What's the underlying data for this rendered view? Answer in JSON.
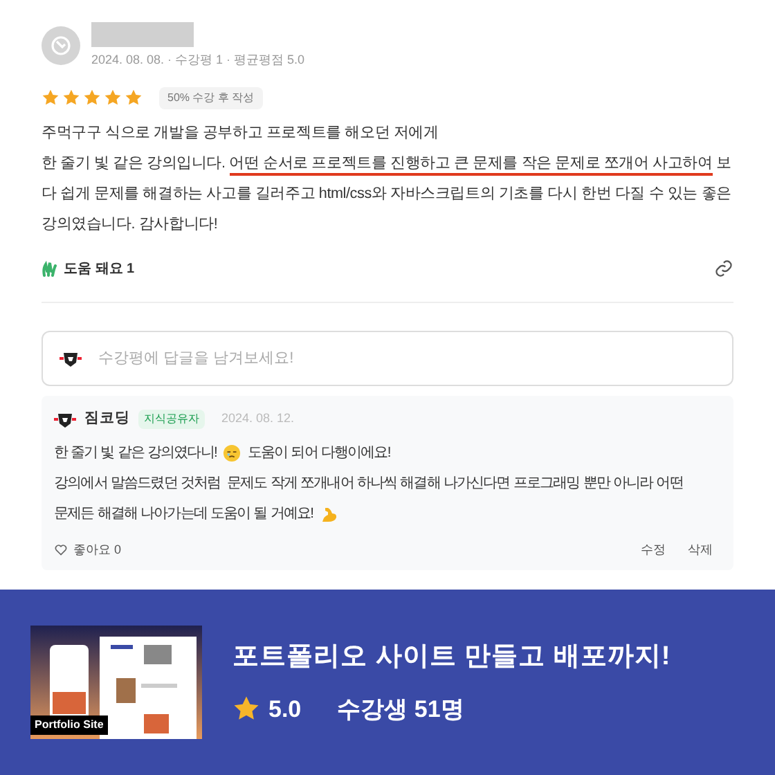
{
  "review": {
    "meta": "2024. 08. 08. · 수강평 1 · 평균평점 5.0",
    "stars": 5,
    "progress_badge": "50% 수강 후 작성",
    "body": [
      {
        "text": "주먹구구 식으로 개발을 공부하고 프로젝트를 해오던 저에게\n한 줄기 빛 같은 강의입니다. ",
        "underlined": false
      },
      {
        "text": "어떤 순서로 프로젝트를 진행하고 큰 문제를 작은 문제로 쪼개어 사고하여",
        "underlined": true
      },
      {
        "text": " 보다 쉽게 문제를 해결하는 사고를 길러주고 html/css와 자바스크립트의 기초를 다시 한번 다질 수 있는 좋은 강의였습니다. 감사합니다!",
        "underlined": false
      }
    ],
    "helpful": "도움 돼요 1"
  },
  "reply_input": {
    "placeholder": "수강평에 답글을 남겨보세요!"
  },
  "reply": {
    "author": "짐코딩",
    "badge": "지식공유자",
    "date": "2024. 08. 12.",
    "body": [
      "한 줄기 빛 같은 강의였다니!",
      "도움이 되어 다행이에요!",
      "강의에서 말씀드렸던 것처럼  문제도 작게 쪼개내어 하나씩 해결해 나가신다면 프로그래밍 뿐만 아니라 어떤",
      "문제든 해결해 나아가는데 도움이 될 거예요!"
    ],
    "likes": "좋아요 0",
    "actions": [
      "수정",
      "삭제"
    ]
  },
  "banner": {
    "thumbnail_label": "Portfolio Site",
    "title": "포트폴리오 사이트 만들고 배포까지!",
    "rating": "5.0",
    "students": "수강생 51명"
  }
}
